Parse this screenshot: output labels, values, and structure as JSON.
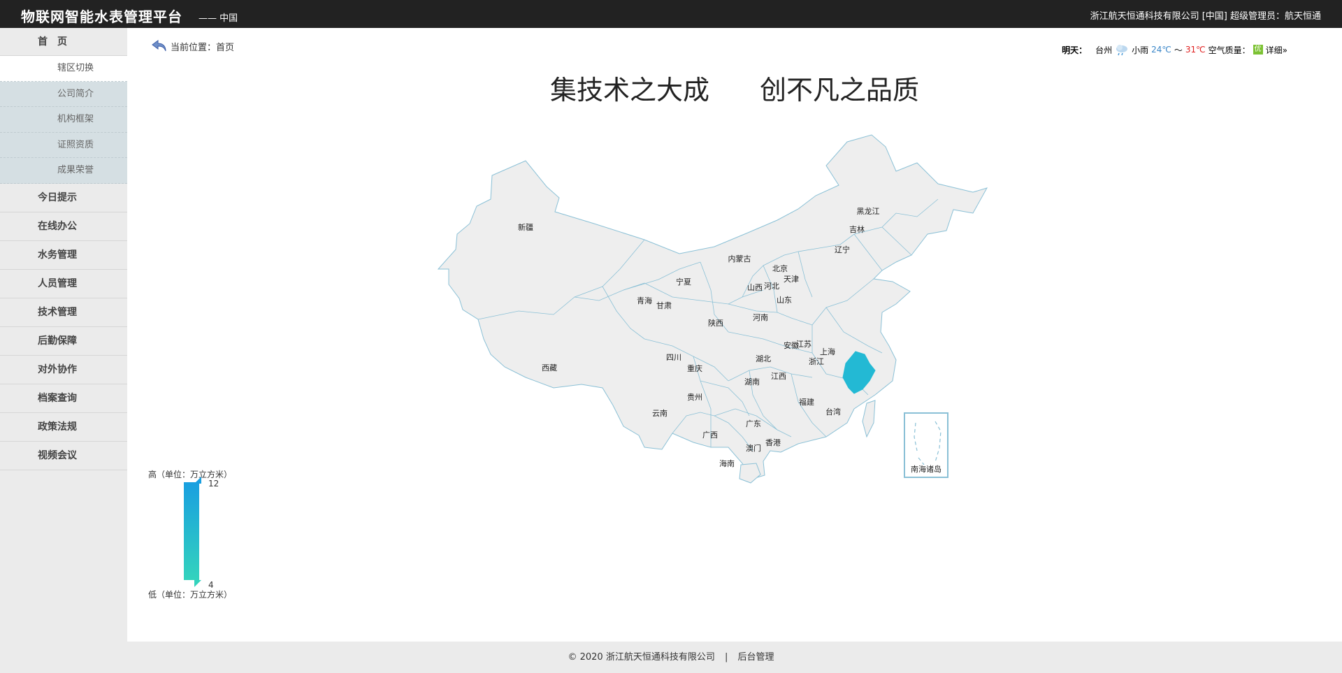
{
  "header": {
    "title": "物联网智能水表管理平台",
    "region": "—— 中国",
    "account": "浙江航天恒通科技有限公司 [中国] 超级管理员：航天恒通"
  },
  "sidebar": {
    "home": "首页",
    "sub_items": [
      {
        "label": "辖区切换",
        "active": true
      },
      {
        "label": "公司简介"
      },
      {
        "label": "机构框架"
      },
      {
        "label": "证照资质"
      },
      {
        "label": "成果荣誉"
      }
    ],
    "items": [
      {
        "label": "今日提示"
      },
      {
        "label": "在线办公"
      },
      {
        "label": "水务管理"
      },
      {
        "label": "人员管理"
      },
      {
        "label": "技术管理"
      },
      {
        "label": "后勤保障"
      },
      {
        "label": "对外协作"
      },
      {
        "label": "档案查询"
      },
      {
        "label": "政策法规"
      },
      {
        "label": "视频会议"
      }
    ]
  },
  "breadcrumb": {
    "prefix": "当前位置：",
    "current": "首页",
    "icon": "back-arrow-icon"
  },
  "weather": {
    "label": "明天：",
    "city": "台州",
    "icon": "cloud-rain-icon",
    "condition": "小雨",
    "low": "24℃",
    "tilde": "～",
    "high": "31℃",
    "aq_label": "空气质量：",
    "aq_badge": "优",
    "detail": "详细»"
  },
  "slogan": {
    "left": "集技术之大成",
    "right": "创不凡之品质"
  },
  "map": {
    "highlight_color": "#23b9d4",
    "base_color": "#eeeeee",
    "border_color": "#8ac0d6",
    "highlighted": "浙江",
    "provinces": [
      "新疆",
      "西藏",
      "青海",
      "甘肃",
      "宁夏",
      "内蒙古",
      "黑龙江",
      "吉林",
      "辽宁",
      "北京",
      "天津",
      "河北",
      "山西",
      "山东",
      "河南",
      "陕西",
      "四川",
      "重庆",
      "湖北",
      "安徽",
      "江苏",
      "上海",
      "浙江",
      "江西",
      "湖南",
      "贵州",
      "云南",
      "广西",
      "广东",
      "福建",
      "台湾",
      "香港",
      "澳门",
      "海南"
    ],
    "inset_label": "南海诸岛"
  },
  "legend": {
    "high_label": "高（单位：万立方米）",
    "low_label": "低（单位：万立方米）",
    "max": "12",
    "min": "4",
    "color_top": "#199fe0",
    "color_bottom": "#33d3bd"
  },
  "footer": {
    "copyright": "© 2020 浙江航天恒通科技有限公司",
    "separator": "|",
    "admin_link": "后台管理"
  }
}
